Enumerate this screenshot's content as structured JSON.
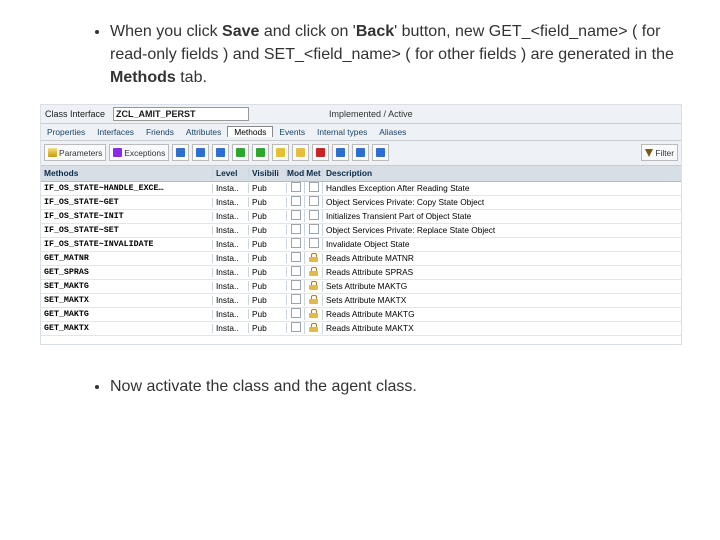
{
  "bullet1_parts": {
    "p1": "When you click ",
    "b1": "Save",
    "p2": " and click on '",
    "b2": "Back",
    "p3": "' button, new GET_<field_name> ( for read-only fields ) and SET_<field_name> ( for other fields ) are generated in the ",
    "b3": "Methods",
    "p4": " tab."
  },
  "bullet2": "Now activate the class and the agent class.",
  "header": {
    "label": "Class Interface",
    "value": "ZCL_AMIT_PERST",
    "status": "Implemented / Active"
  },
  "tabs": [
    "Properties",
    "Interfaces",
    "Friends",
    "Attributes",
    "Methods",
    "Events",
    "Internal types",
    "Aliases"
  ],
  "active_tab": "Methods",
  "toolbar": {
    "params": "Parameters",
    "exceptions": "Exceptions",
    "filter": "Filter"
  },
  "columns": {
    "method": "Methods",
    "level": "Level",
    "vis": "Visibili",
    "mod": "Mod",
    "met": "Met",
    "desc": "Description"
  },
  "rows": [
    {
      "m": "IF_OS_STATE~HANDLE_EXCE…",
      "l": "Insta..",
      "v": "Pub",
      "lock": false,
      "d": "Handles Exception After Reading State"
    },
    {
      "m": "IF_OS_STATE~GET",
      "l": "Insta..",
      "v": "Pub",
      "lock": false,
      "d": "Object Services Private: Copy State Object"
    },
    {
      "m": "IF_OS_STATE~INIT",
      "l": "Insta..",
      "v": "Pub",
      "lock": false,
      "d": "Initializes Transient Part of Object State"
    },
    {
      "m": "IF_OS_STATE~SET",
      "l": "Insta..",
      "v": "Pub",
      "lock": false,
      "d": "Object Services Private: Replace State Object"
    },
    {
      "m": "IF_OS_STATE~INVALIDATE",
      "l": "Insta..",
      "v": "Pub",
      "lock": false,
      "d": "Invalidate Object State"
    },
    {
      "m": "GET_MATNR",
      "l": "Insta..",
      "v": "Pub",
      "lock": true,
      "d": "Reads Attribute MATNR"
    },
    {
      "m": "GET_SPRAS",
      "l": "Insta..",
      "v": "Pub",
      "lock": true,
      "d": "Reads Attribute SPRAS"
    },
    {
      "m": "SET_MAKTG",
      "l": "Insta..",
      "v": "Pub",
      "lock": true,
      "d": "Sets Attribute MAKTG"
    },
    {
      "m": "SET_MAKTX",
      "l": "Insta..",
      "v": "Pub",
      "lock": true,
      "d": "Sets Attribute MAKTX"
    },
    {
      "m": "GET_MAKTG",
      "l": "Insta..",
      "v": "Pub",
      "lock": true,
      "d": "Reads Attribute MAKTG"
    },
    {
      "m": "GET_MAKTX",
      "l": "Insta..",
      "v": "Pub",
      "lock": true,
      "d": "Reads Attribute MAKTX"
    }
  ]
}
